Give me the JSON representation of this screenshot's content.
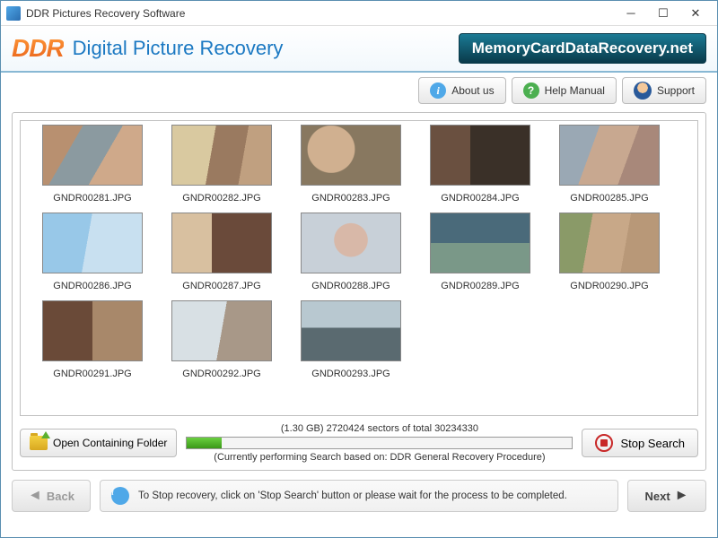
{
  "window": {
    "title": "DDR Pictures Recovery Software"
  },
  "brand": {
    "logo": "DDR",
    "product": "Digital Picture Recovery",
    "url": "MemoryCardDataRecovery.net"
  },
  "toolbar": {
    "about": "About us",
    "help": "Help Manual",
    "support": "Support"
  },
  "thumbnails": [
    {
      "name": "GNDR00281.JPG"
    },
    {
      "name": "GNDR00282.JPG"
    },
    {
      "name": "GNDR00283.JPG"
    },
    {
      "name": "GNDR00284.JPG"
    },
    {
      "name": "GNDR00285.JPG"
    },
    {
      "name": "GNDR00286.JPG"
    },
    {
      "name": "GNDR00287.JPG"
    },
    {
      "name": "GNDR00288.JPG"
    },
    {
      "name": "GNDR00289.JPG"
    },
    {
      "name": "GNDR00290.JPG"
    },
    {
      "name": "GNDR00291.JPG"
    },
    {
      "name": "GNDR00292.JPG"
    },
    {
      "name": "GNDR00293.JPG"
    }
  ],
  "progress": {
    "open_folder": "Open Containing Folder",
    "sectors": "(1.30 GB) 2720424  sectors  of  total 30234330",
    "mode": "(Currently performing Search based on:  DDR General Recovery Procedure)",
    "stop": "Stop Search"
  },
  "footer": {
    "back": "Back",
    "info": "To Stop recovery, click on 'Stop Search' button or please wait for the process to be completed.",
    "next": "Next"
  }
}
